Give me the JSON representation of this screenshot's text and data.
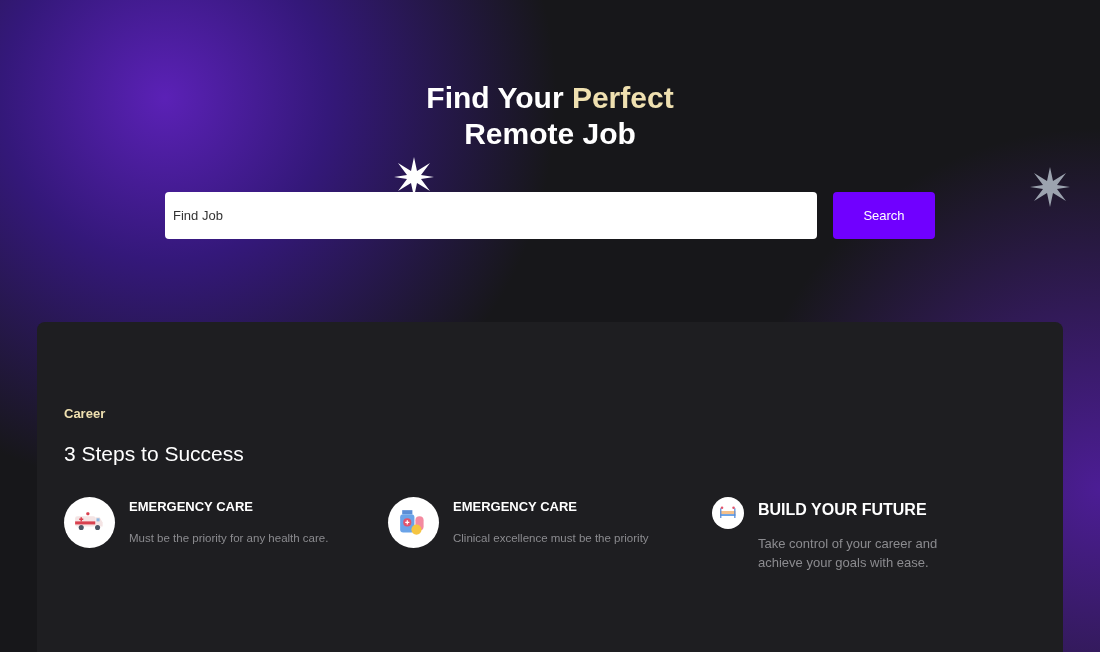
{
  "hero": {
    "title_start": "Find Your",
    "title_highlight": "Perfect",
    "title_end": "Remote Job"
  },
  "search": {
    "placeholder": "Find Job",
    "button": "Search"
  },
  "section": {
    "eyebrow": "Career",
    "heading": "3 Steps to Success",
    "steps": [
      {
        "kind": "standard",
        "title": "EMERGENCY CARE",
        "text": "Must be the priority for any health care."
      },
      {
        "kind": "standard",
        "title": "EMERGENCY CARE",
        "text": "Clinical excellence must be the priority"
      },
      {
        "kind": "featured",
        "title": "BUILD YOUR FUTURE",
        "text": "Take control of your career and achieve your goals with ease."
      }
    ]
  }
}
